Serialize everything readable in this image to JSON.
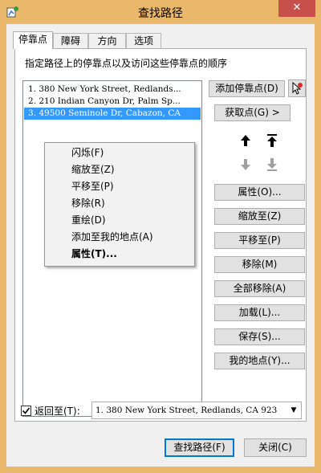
{
  "window": {
    "title": "查找路径",
    "close_label": "✕"
  },
  "tabs": [
    {
      "label": "停靠点",
      "active": true
    },
    {
      "label": "障碍",
      "active": false
    },
    {
      "label": "方向",
      "active": false
    },
    {
      "label": "选项",
      "active": false
    }
  ],
  "description": "指定路径上的停靠点以及访问这些停靠点的顺序",
  "stops": [
    "1.  380 New York Street, Redlands...",
    "2.  210 Indian Canyon Dr, Palm Sp...",
    "3.  49500 Seminole Dr, Cabazon, CA"
  ],
  "selected_stop": 2,
  "context_menu": [
    "闪烁(F)",
    "缩放至(Z)",
    "平移至(P)",
    "移除(R)",
    "重绘(D)",
    "添加至我的地点(A)",
    "属性(T)..."
  ],
  "buttons": {
    "add_stop": "添加停靠点(D)",
    "get_points": "获取点(G)  >",
    "properties": "属性(O)...",
    "zoom_to": "缩放至(Z)",
    "pan_to": "平移至(P)",
    "remove": "移除(M)",
    "remove_all": "全部移除(A)",
    "load": "加载(L)...",
    "save": "保存(S)...",
    "my_places": "我的地点(Y)...",
    "find_route": "查找路径(F)",
    "close": "关闭(C)"
  },
  "return_to": {
    "checked": true,
    "label": "返回至(T):",
    "value": "1.  380 New York Street, Redlands, CA 923"
  },
  "icons": {
    "app": "route-app-icon",
    "add_point_tool": "add-point-cursor-icon",
    "move_up": "arrow-up-icon",
    "move_top": "arrow-top-icon",
    "move_down": "arrow-down-icon",
    "move_bottom": "arrow-bottom-icon"
  },
  "colors": {
    "titlebar": "#e9b86a",
    "close": "#c7504a",
    "selection": "#3399ff"
  }
}
